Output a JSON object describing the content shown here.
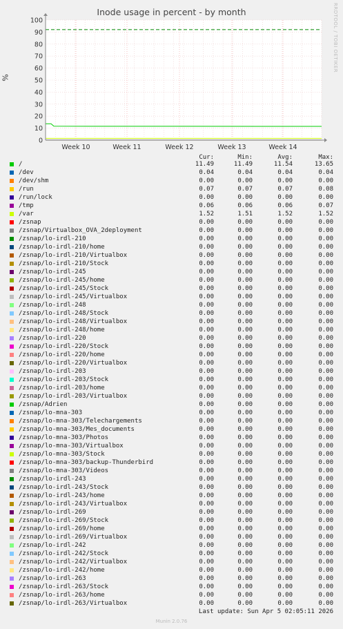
{
  "title": "Inode usage in percent - by month",
  "side_label": "RRDTOOL / TOBI OETIKER",
  "footer": {
    "last_update": "Last update: Sun Apr  5 02:05:11 2026",
    "munin": "Munin 2.0.76"
  },
  "legend_header": {
    "cur": "Cur:",
    "min": "Min:",
    "avg": "Avg:",
    "max": "Max:"
  },
  "chart_data": {
    "type": "line",
    "title": "Inode usage in percent - by month",
    "ylabel": "%",
    "ylim": [
      0,
      100
    ],
    "yticks": [
      0,
      10,
      20,
      30,
      40,
      50,
      60,
      70,
      80,
      90,
      100
    ],
    "xlim": [
      0,
      100
    ],
    "x_tick_labels": [
      {
        "label": "Week 10",
        "x": 11
      },
      {
        "label": "Week 11",
        "x": 29.5
      },
      {
        "label": "Week 12",
        "x": 48.5
      },
      {
        "label": "Week 13",
        "x": 67.5
      },
      {
        "label": "Week 14",
        "x": 86
      }
    ],
    "warning_line": 92,
    "grid": true,
    "series": [
      {
        "name": "/",
        "color": "#00cc00",
        "cur": "11.49",
        "min": "11.49",
        "avg": "11.54",
        "max": "13.65",
        "points": [
          [
            0,
            13.65
          ],
          [
            2,
            13.65
          ],
          [
            3,
            11.6
          ],
          [
            100,
            11.49
          ]
        ]
      },
      {
        "name": "/dev",
        "color": "#0066b3",
        "cur": "0.04",
        "min": "0.04",
        "avg": "0.04",
        "max": "0.04",
        "points": [
          [
            0,
            0.04
          ],
          [
            100,
            0.04
          ]
        ]
      },
      {
        "name": "/dev/shm",
        "color": "#ff8000",
        "cur": "0.00",
        "min": "0.00",
        "avg": "0.00",
        "max": "0.00",
        "points": [
          [
            0,
            0
          ],
          [
            100,
            0
          ]
        ]
      },
      {
        "name": "/run",
        "color": "#ffcc00",
        "cur": "0.07",
        "min": "0.07",
        "avg": "0.07",
        "max": "0.08",
        "points": [
          [
            0,
            0.08
          ],
          [
            100,
            0.07
          ]
        ]
      },
      {
        "name": "/run/lock",
        "color": "#330099",
        "cur": "0.00",
        "min": "0.00",
        "avg": "0.00",
        "max": "0.00",
        "points": [
          [
            0,
            0
          ],
          [
            100,
            0
          ]
        ]
      },
      {
        "name": "/tmp",
        "color": "#990099",
        "cur": "0.06",
        "min": "0.06",
        "avg": "0.06",
        "max": "0.07",
        "points": [
          [
            0,
            0.07
          ],
          [
            100,
            0.06
          ]
        ]
      },
      {
        "name": "/var",
        "color": "#ccff00",
        "cur": "1.52",
        "min": "1.51",
        "avg": "1.52",
        "max": "1.52",
        "points": [
          [
            0,
            1.52
          ],
          [
            100,
            1.52
          ]
        ]
      },
      {
        "name": "/zsnap",
        "color": "#ff0000",
        "cur": "0.00",
        "min": "0.00",
        "avg": "0.00",
        "max": "0.00",
        "points": [
          [
            0,
            0
          ],
          [
            100,
            0
          ]
        ]
      },
      {
        "name": "/zsnap/Virtualbox_OVA_2deployment",
        "color": "#808080",
        "cur": "0.00",
        "min": "0.00",
        "avg": "0.00",
        "max": "0.00",
        "points": [
          [
            0,
            0
          ],
          [
            100,
            0
          ]
        ]
      },
      {
        "name": "/zsnap/lo-irdl-210",
        "color": "#008f00",
        "cur": "0.00",
        "min": "0.00",
        "avg": "0.00",
        "max": "0.00",
        "points": [
          [
            0,
            0
          ],
          [
            100,
            0
          ]
        ]
      },
      {
        "name": "/zsnap/lo-irdl-210/home",
        "color": "#00487d",
        "cur": "0.00",
        "min": "0.00",
        "avg": "0.00",
        "max": "0.00",
        "points": [
          [
            0,
            0
          ],
          [
            100,
            0
          ]
        ]
      },
      {
        "name": "/zsnap/lo-irdl-210/Virtualbox",
        "color": "#b35a00",
        "cur": "0.00",
        "min": "0.00",
        "avg": "0.00",
        "max": "0.00",
        "points": [
          [
            0,
            0
          ],
          [
            100,
            0
          ]
        ]
      },
      {
        "name": "/zsnap/lo-irdl-210/Stock",
        "color": "#b38f00",
        "cur": "0.00",
        "min": "0.00",
        "avg": "0.00",
        "max": "0.00",
        "points": [
          [
            0,
            0
          ],
          [
            100,
            0
          ]
        ]
      },
      {
        "name": "/zsnap/lo-irdl-245",
        "color": "#6b006b",
        "cur": "0.00",
        "min": "0.00",
        "avg": "0.00",
        "max": "0.00",
        "points": [
          [
            0,
            0
          ],
          [
            100,
            0
          ]
        ]
      },
      {
        "name": "/zsnap/lo-irdl-245/home",
        "color": "#8fb300",
        "cur": "0.00",
        "min": "0.00",
        "avg": "0.00",
        "max": "0.00",
        "points": [
          [
            0,
            0
          ],
          [
            100,
            0
          ]
        ]
      },
      {
        "name": "/zsnap/lo-irdl-245/Stock",
        "color": "#b30000",
        "cur": "0.00",
        "min": "0.00",
        "avg": "0.00",
        "max": "0.00",
        "points": [
          [
            0,
            0
          ],
          [
            100,
            0
          ]
        ]
      },
      {
        "name": "/zsnap/lo-irdl-245/Virtualbox",
        "color": "#bebebe",
        "cur": "0.00",
        "min": "0.00",
        "avg": "0.00",
        "max": "0.00",
        "points": [
          [
            0,
            0
          ],
          [
            100,
            0
          ]
        ]
      },
      {
        "name": "/zsnap/lo-irdl-248",
        "color": "#80ff80",
        "cur": "0.00",
        "min": "0.00",
        "avg": "0.00",
        "max": "0.00",
        "points": [
          [
            0,
            0
          ],
          [
            100,
            0
          ]
        ]
      },
      {
        "name": "/zsnap/lo-irdl-248/Stock",
        "color": "#80c9ff",
        "cur": "0.00",
        "min": "0.00",
        "avg": "0.00",
        "max": "0.00",
        "points": [
          [
            0,
            0
          ],
          [
            100,
            0
          ]
        ]
      },
      {
        "name": "/zsnap/lo-irdl-248/Virtualbox",
        "color": "#ffc080",
        "cur": "0.00",
        "min": "0.00",
        "avg": "0.00",
        "max": "0.00",
        "points": [
          [
            0,
            0
          ],
          [
            100,
            0
          ]
        ]
      },
      {
        "name": "/zsnap/lo-irdl-248/home",
        "color": "#ffe680",
        "cur": "0.00",
        "min": "0.00",
        "avg": "0.00",
        "max": "0.00",
        "points": [
          [
            0,
            0
          ],
          [
            100,
            0
          ]
        ]
      },
      {
        "name": "/zsnap/lo-irdl-220",
        "color": "#aa80ff",
        "cur": "0.00",
        "min": "0.00",
        "avg": "0.00",
        "max": "0.00",
        "points": [
          [
            0,
            0
          ],
          [
            100,
            0
          ]
        ]
      },
      {
        "name": "/zsnap/lo-irdl-220/Stock",
        "color": "#ee00cc",
        "cur": "0.00",
        "min": "0.00",
        "avg": "0.00",
        "max": "0.00",
        "points": [
          [
            0,
            0
          ],
          [
            100,
            0
          ]
        ]
      },
      {
        "name": "/zsnap/lo-irdl-220/home",
        "color": "#ff8080",
        "cur": "0.00",
        "min": "0.00",
        "avg": "0.00",
        "max": "0.00",
        "points": [
          [
            0,
            0
          ],
          [
            100,
            0
          ]
        ]
      },
      {
        "name": "/zsnap/lo-irdl-220/Virtualbox",
        "color": "#666600",
        "cur": "0.00",
        "min": "0.00",
        "avg": "0.00",
        "max": "0.00",
        "points": [
          [
            0,
            0
          ],
          [
            100,
            0
          ]
        ]
      },
      {
        "name": "/zsnap/lo-irdl-203",
        "color": "#ffbfff",
        "cur": "0.00",
        "min": "0.00",
        "avg": "0.00",
        "max": "0.00",
        "points": [
          [
            0,
            0
          ],
          [
            100,
            0
          ]
        ]
      },
      {
        "name": "/zsnap/lo-irdl-203/Stock",
        "color": "#00ffcc",
        "cur": "0.00",
        "min": "0.00",
        "avg": "0.00",
        "max": "0.00",
        "points": [
          [
            0,
            0
          ],
          [
            100,
            0
          ]
        ]
      },
      {
        "name": "/zsnap/lo-irdl-203/home",
        "color": "#cc6699",
        "cur": "0.00",
        "min": "0.00",
        "avg": "0.00",
        "max": "0.00",
        "points": [
          [
            0,
            0
          ],
          [
            100,
            0
          ]
        ]
      },
      {
        "name": "/zsnap/lo-irdl-203/Virtualbox",
        "color": "#999900",
        "cur": "0.00",
        "min": "0.00",
        "avg": "0.00",
        "max": "0.00",
        "points": [
          [
            0,
            0
          ],
          [
            100,
            0
          ]
        ]
      },
      {
        "name": "/zsnap/Adrien",
        "color": "#00cc00",
        "cur": "0.00",
        "min": "0.00",
        "avg": "0.00",
        "max": "0.00",
        "points": [
          [
            0,
            0
          ],
          [
            100,
            0
          ]
        ]
      },
      {
        "name": "/zsnap/lo-mna-303",
        "color": "#0066b3",
        "cur": "0.00",
        "min": "0.00",
        "avg": "0.00",
        "max": "0.00",
        "points": [
          [
            0,
            0
          ],
          [
            100,
            0
          ]
        ]
      },
      {
        "name": "/zsnap/lo-mna-303/Telechargements",
        "color": "#ff8000",
        "cur": "0.00",
        "min": "0.00",
        "avg": "0.00",
        "max": "0.00",
        "points": [
          [
            0,
            0
          ],
          [
            100,
            0
          ]
        ]
      },
      {
        "name": "/zsnap/lo-mna-303/Mes_documents",
        "color": "#ffcc00",
        "cur": "0.00",
        "min": "0.00",
        "avg": "0.00",
        "max": "0.00",
        "points": [
          [
            0,
            0
          ],
          [
            100,
            0
          ]
        ]
      },
      {
        "name": "/zsnap/lo-mna-303/Photos",
        "color": "#330099",
        "cur": "0.00",
        "min": "0.00",
        "avg": "0.00",
        "max": "0.00",
        "points": [
          [
            0,
            0
          ],
          [
            100,
            0
          ]
        ]
      },
      {
        "name": "/zsnap/lo-mna-303/Virtualbox",
        "color": "#990099",
        "cur": "0.00",
        "min": "0.00",
        "avg": "0.00",
        "max": "0.00",
        "points": [
          [
            0,
            0
          ],
          [
            100,
            0
          ]
        ]
      },
      {
        "name": "/zsnap/lo-mna-303/Stock",
        "color": "#ccff00",
        "cur": "0.00",
        "min": "0.00",
        "avg": "0.00",
        "max": "0.00",
        "points": [
          [
            0,
            0
          ],
          [
            100,
            0
          ]
        ]
      },
      {
        "name": "/zsnap/lo-mna-303/backup-Thunderbird",
        "color": "#ff0000",
        "cur": "0.00",
        "min": "0.00",
        "avg": "0.00",
        "max": "0.00",
        "points": [
          [
            0,
            0
          ],
          [
            100,
            0
          ]
        ]
      },
      {
        "name": "/zsnap/lo-mna-303/Videos",
        "color": "#808080",
        "cur": "0.00",
        "min": "0.00",
        "avg": "0.00",
        "max": "0.00",
        "points": [
          [
            0,
            0
          ],
          [
            100,
            0
          ]
        ]
      },
      {
        "name": "/zsnap/lo-irdl-243",
        "color": "#008f00",
        "cur": "0.00",
        "min": "0.00",
        "avg": "0.00",
        "max": "0.00",
        "points": [
          [
            0,
            0
          ],
          [
            100,
            0
          ]
        ]
      },
      {
        "name": "/zsnap/lo-irdl-243/Stock",
        "color": "#00487d",
        "cur": "0.00",
        "min": "0.00",
        "avg": "0.00",
        "max": "0.00",
        "points": [
          [
            0,
            0
          ],
          [
            100,
            0
          ]
        ]
      },
      {
        "name": "/zsnap/lo-irdl-243/home",
        "color": "#b35a00",
        "cur": "0.00",
        "min": "0.00",
        "avg": "0.00",
        "max": "0.00",
        "points": [
          [
            0,
            0
          ],
          [
            100,
            0
          ]
        ]
      },
      {
        "name": "/zsnap/lo-irdl-243/Virtualbox",
        "color": "#b38f00",
        "cur": "0.00",
        "min": "0.00",
        "avg": "0.00",
        "max": "0.00",
        "points": [
          [
            0,
            0
          ],
          [
            100,
            0
          ]
        ]
      },
      {
        "name": "/zsnap/lo-irdl-269",
        "color": "#6b006b",
        "cur": "0.00",
        "min": "0.00",
        "avg": "0.00",
        "max": "0.00",
        "points": [
          [
            0,
            0
          ],
          [
            100,
            0
          ]
        ]
      },
      {
        "name": "/zsnap/lo-irdl-269/Stock",
        "color": "#8fb300",
        "cur": "0.00",
        "min": "0.00",
        "avg": "0.00",
        "max": "0.00",
        "points": [
          [
            0,
            0
          ],
          [
            100,
            0
          ]
        ]
      },
      {
        "name": "/zsnap/lo-irdl-269/home",
        "color": "#b30000",
        "cur": "0.00",
        "min": "0.00",
        "avg": "0.00",
        "max": "0.00",
        "points": [
          [
            0,
            0
          ],
          [
            100,
            0
          ]
        ]
      },
      {
        "name": "/zsnap/lo-irdl-269/Virtualbox",
        "color": "#bebebe",
        "cur": "0.00",
        "min": "0.00",
        "avg": "0.00",
        "max": "0.00",
        "points": [
          [
            0,
            0
          ],
          [
            100,
            0
          ]
        ]
      },
      {
        "name": "/zsnap/lo-irdl-242",
        "color": "#80ff80",
        "cur": "0.00",
        "min": "0.00",
        "avg": "0.00",
        "max": "0.00",
        "points": [
          [
            0,
            0
          ],
          [
            100,
            0
          ]
        ]
      },
      {
        "name": "/zsnap/lo-irdl-242/Stock",
        "color": "#80c9ff",
        "cur": "0.00",
        "min": "0.00",
        "avg": "0.00",
        "max": "0.00",
        "points": [
          [
            0,
            0
          ],
          [
            100,
            0
          ]
        ]
      },
      {
        "name": "/zsnap/lo-irdl-242/Virtualbox",
        "color": "#ffc080",
        "cur": "0.00",
        "min": "0.00",
        "avg": "0.00",
        "max": "0.00",
        "points": [
          [
            0,
            0
          ],
          [
            100,
            0
          ]
        ]
      },
      {
        "name": "/zsnap/lo-irdl-242/home",
        "color": "#ffe680",
        "cur": "0.00",
        "min": "0.00",
        "avg": "0.00",
        "max": "0.00",
        "points": [
          [
            0,
            0
          ],
          [
            100,
            0
          ]
        ]
      },
      {
        "name": "/zsnap/lo-irdl-263",
        "color": "#aa80ff",
        "cur": "0.00",
        "min": "0.00",
        "avg": "0.00",
        "max": "0.00",
        "points": [
          [
            0,
            0
          ],
          [
            100,
            0
          ]
        ]
      },
      {
        "name": "/zsnap/lo-irdl-263/Stock",
        "color": "#ee00cc",
        "cur": "0.00",
        "min": "0.00",
        "avg": "0.00",
        "max": "0.00",
        "points": [
          [
            0,
            0
          ],
          [
            100,
            0
          ]
        ]
      },
      {
        "name": "/zsnap/lo-irdl-263/home",
        "color": "#ff8080",
        "cur": "0.00",
        "min": "0.00",
        "avg": "0.00",
        "max": "0.00",
        "points": [
          [
            0,
            0
          ],
          [
            100,
            0
          ]
        ]
      },
      {
        "name": "/zsnap/lo-irdl-263/Virtualbox",
        "color": "#666600",
        "cur": "0.00",
        "min": "0.00",
        "avg": "0.00",
        "max": "0.00",
        "points": [
          [
            0,
            0
          ],
          [
            100,
            0
          ]
        ]
      }
    ]
  }
}
